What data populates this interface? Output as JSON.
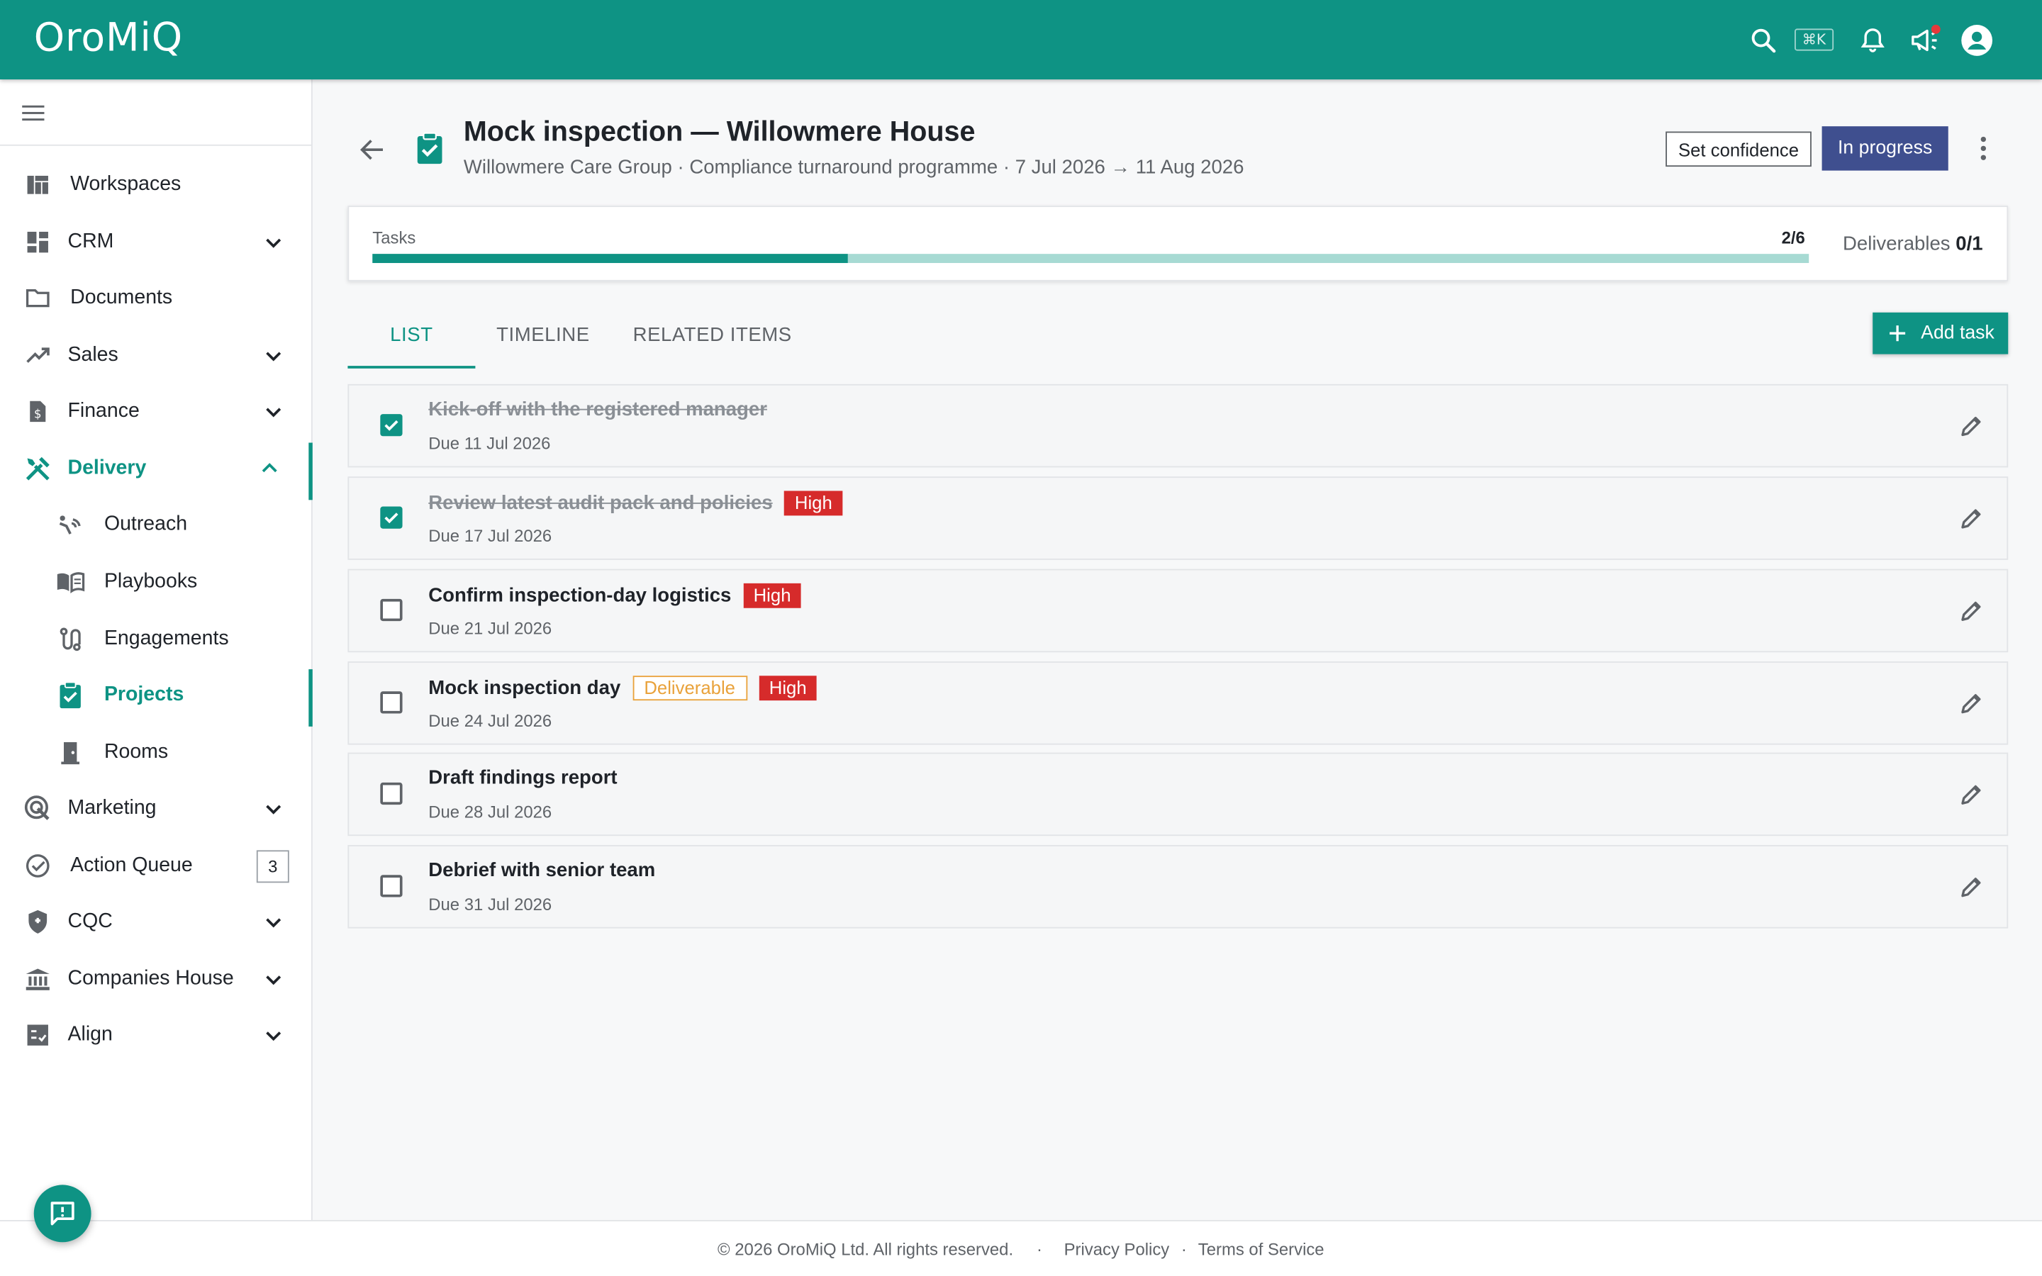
{
  "app": {
    "logo": "OroMiQ"
  },
  "topbar": {
    "shortcut": "⌘K",
    "icons": [
      "search-icon",
      "bell-icon",
      "megaphone-icon",
      "account-icon"
    ],
    "notification_color": "#e5393b"
  },
  "colors": {
    "primary": "#0e9384",
    "status_button": "#3f4f8f",
    "high": "#d62b2b",
    "deliverable": "#e9a23b"
  },
  "sidebar": {
    "items": [
      {
        "label": "Workspaces",
        "icon": "workspaces-icon"
      },
      {
        "label": "CRM",
        "icon": "dashboard-icon"
      },
      {
        "label": "Documents",
        "icon": "folder-icon"
      },
      {
        "label": "Sales",
        "icon": "trending-up-icon"
      },
      {
        "label": "Finance",
        "icon": "invoice-icon"
      },
      {
        "label": "Delivery",
        "icon": "tools-icon"
      },
      {
        "label": "Outreach",
        "icon": "outreach-icon"
      },
      {
        "label": "Playbooks",
        "icon": "book-icon"
      },
      {
        "label": "Engagements",
        "icon": "route-icon"
      },
      {
        "label": "Projects",
        "icon": "clipboard-check-icon"
      },
      {
        "label": "Rooms",
        "icon": "door-icon"
      },
      {
        "label": "Marketing",
        "icon": "target-icon"
      },
      {
        "label": "Action Queue",
        "icon": "check-circle-icon",
        "badge": "3"
      },
      {
        "label": "CQC",
        "icon": "shield-icon"
      },
      {
        "label": "Companies House",
        "icon": "bank-icon"
      },
      {
        "label": "Align",
        "icon": "checklist-icon"
      }
    ]
  },
  "project": {
    "title": "Mock inspection — Willowmere House",
    "subtitle": "Willowmere Care Group · Compliance turnaround programme · 7 Jul 2026 → 11 Aug 2026",
    "confidence_label": "Set confidence",
    "status_label": "In progress"
  },
  "progress": {
    "tasks_label": "Tasks",
    "tasks_done": 2,
    "tasks_total": 6,
    "tasks_count_text": "2/6",
    "deliverables_label": "Deliverables",
    "deliverables_count": "0/1"
  },
  "tabs": [
    {
      "label": "LIST",
      "active": true
    },
    {
      "label": "TIMELINE",
      "active": false
    },
    {
      "label": "RELATED ITEMS",
      "active": false
    }
  ],
  "add_task_label": "Add task",
  "tasks": [
    {
      "title": "Kick-off with the registered manager",
      "due": "Due 11 Jul 2026",
      "done": true,
      "tags": []
    },
    {
      "title": "Review latest audit pack and policies",
      "due": "Due 17 Jul 2026",
      "done": true,
      "tags": [
        "High"
      ]
    },
    {
      "title": "Confirm inspection-day logistics",
      "due": "Due 21 Jul 2026",
      "done": false,
      "tags": [
        "High"
      ]
    },
    {
      "title": "Mock inspection day",
      "due": "Due 24 Jul 2026",
      "done": false,
      "tags": [
        "Deliverable",
        "High"
      ]
    },
    {
      "title": "Draft findings report",
      "due": "Due 28 Jul 2026",
      "done": false,
      "tags": []
    },
    {
      "title": "Debrief with senior team",
      "due": "Due 31 Jul 2026",
      "done": false,
      "tags": []
    }
  ],
  "footer": {
    "copyright": "© 2026 OroMiQ Ltd. All rights reserved.",
    "separator": "·",
    "privacy": "Privacy Policy",
    "terms": "Terms of Service"
  }
}
